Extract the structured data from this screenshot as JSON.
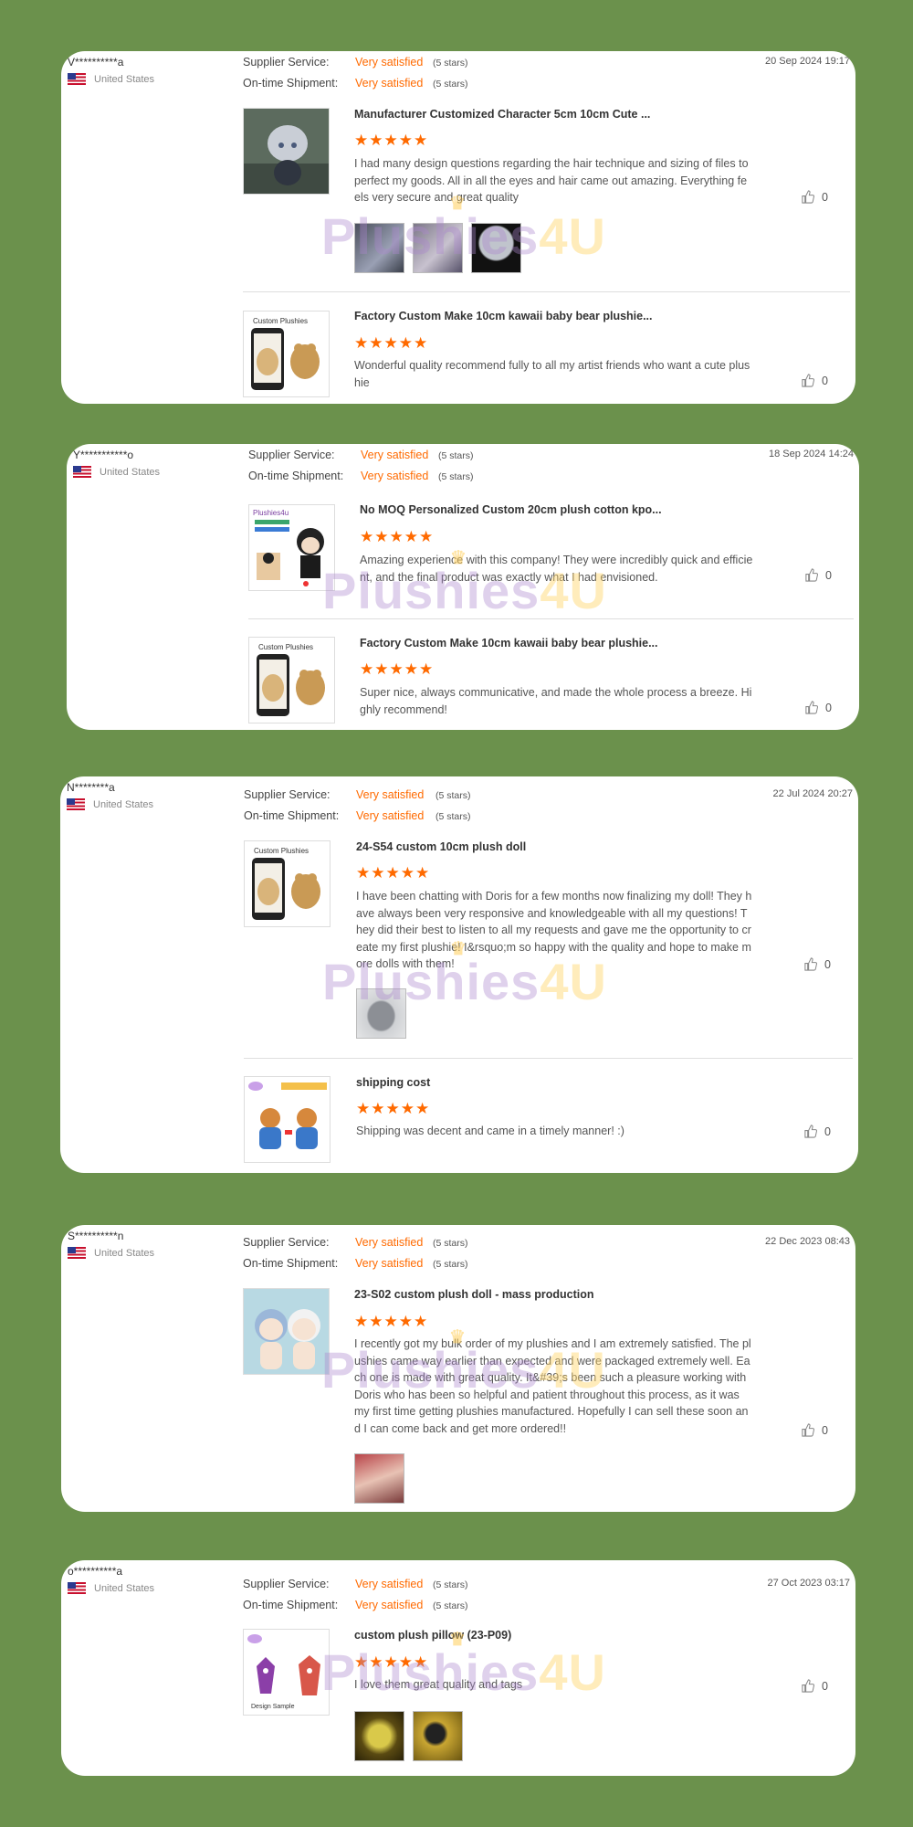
{
  "watermark": {
    "part1": "Plushies",
    "part2": "4U"
  },
  "colors": {
    "background": "#6b914c",
    "accent": "#ff6a00"
  },
  "reviews": [
    {
      "buyer": "V**********a",
      "country": "United States",
      "supplier_label": "Supplier Service:",
      "supplier_value": "Very satisfied",
      "supplier_stars": "(5 stars)",
      "shipment_label": "On-time Shipment:",
      "shipment_value": "Very satisfied",
      "shipment_stars": "(5 stars)",
      "date": "20 Sep 2024 19:17",
      "items": [
        {
          "title": "Manufacturer Customized Character 5cm 10cm Cute ...",
          "rating": "★★★★★",
          "text": "I had many design questions regarding the hair technique and sizing of files to perfect my goods. All in all the eyes and hair came out amazing. Everything feels very secure and great quality",
          "likes": "0"
        },
        {
          "title": "Factory Custom Make 10cm kawaii baby bear plushie...",
          "rating": "★★★★★",
          "text": "Wonderful quality recommend fully to all my artist friends who want a cute plushie",
          "likes": "0"
        }
      ]
    },
    {
      "buyer": "Y***********o",
      "country": "United States",
      "supplier_label": "Supplier Service:",
      "supplier_value": "Very satisfied",
      "supplier_stars": "(5 stars)",
      "shipment_label": "On-time Shipment:",
      "shipment_value": "Very satisfied",
      "shipment_stars": "(5 stars)",
      "date": "18 Sep 2024 14:24",
      "items": [
        {
          "title": "No MOQ Personalized Custom 20cm plush cotton kpo...",
          "rating": "★★★★★",
          "text": "Amazing experience with this company! They were incredibly quick and efficient, and the final product was exactly what I had envisioned.",
          "likes": "0"
        },
        {
          "title": "Factory Custom Make 10cm kawaii baby bear plushie...",
          "rating": "★★★★★",
          "text": "Super nice, always communicative, and made the whole process a breeze. Highly recommend!",
          "likes": "0"
        }
      ]
    },
    {
      "buyer": "N********a",
      "country": "United States",
      "supplier_label": "Supplier Service:",
      "supplier_value": "Very satisfied",
      "supplier_stars": "(5 stars)",
      "shipment_label": "On-time Shipment:",
      "shipment_value": "Very satisfied",
      "shipment_stars": "(5 stars)",
      "date": "22 Jul 2024 20:27",
      "items": [
        {
          "title": "24-S54 custom 10cm plush doll",
          "rating": "★★★★★",
          "text": "I have been chatting with Doris for a few months now finalizing my doll! They have always been very responsive and knowledgeable with all my questions! They did their best to listen to all my requests and gave me the opportunity to create my first plushie! I&rsquo;m so happy with the quality and hope to make more dolls with them!",
          "likes": "0"
        },
        {
          "title": "shipping cost",
          "rating": "★★★★★",
          "text": "Shipping was decent and came in a timely manner! :)",
          "likes": "0"
        }
      ]
    },
    {
      "buyer": "S**********n",
      "country": "United States",
      "supplier_label": "Supplier Service:",
      "supplier_value": "Very satisfied",
      "supplier_stars": "(5 stars)",
      "shipment_label": "On-time Shipment:",
      "shipment_value": "Very satisfied",
      "shipment_stars": "(5 stars)",
      "date": "22 Dec 2023 08:43",
      "items": [
        {
          "title": "23-S02 custom plush doll - mass production",
          "rating": "★★★★★",
          "text": "I recently got my bulk order of my plushies and I am extremely satisfied. The plushies came way earlier than expected and were packaged extremely well. Each one is made with great quality. It&#39;s been such a pleasure working with Doris who has been so helpful and patient throughout this process, as it was my first time getting plushies manufactured. Hopefully I can sell these soon and I can come back and get more ordered!!",
          "likes": "0"
        }
      ]
    },
    {
      "buyer": "o**********a",
      "country": "United States",
      "supplier_label": "Supplier Service:",
      "supplier_value": "Very satisfied",
      "supplier_stars": "(5 stars)",
      "shipment_label": "On-time Shipment:",
      "shipment_value": "Very satisfied",
      "shipment_stars": "(5 stars)",
      "date": "27 Oct 2023 03:17",
      "items": [
        {
          "title": "custom plush pillow (23-P09)",
          "rating": "★★★★★",
          "text": "I love them great quality and tags",
          "likes": "0"
        }
      ]
    }
  ]
}
